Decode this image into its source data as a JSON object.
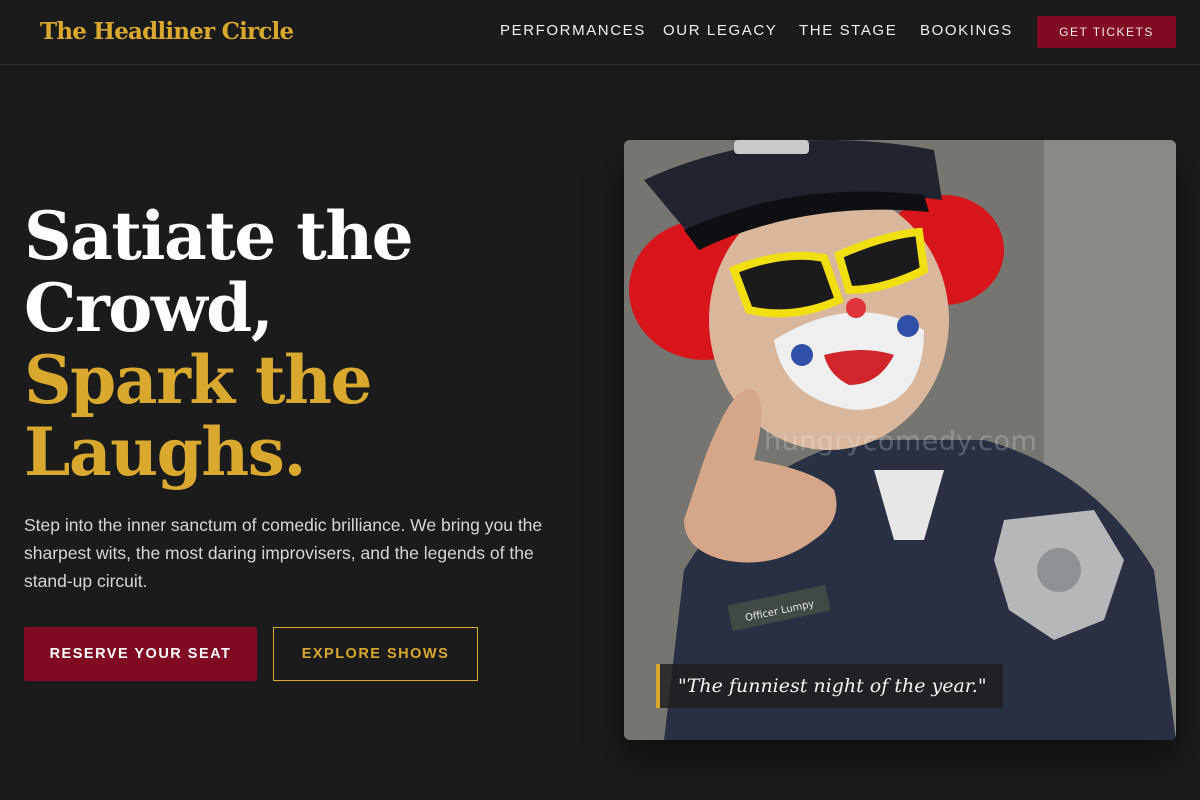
{
  "brand": {
    "name": "The Headliner Circle"
  },
  "nav": {
    "items": [
      "PERFORMANCES",
      "OUR LEGACY",
      "THE STAGE",
      "BOOKINGS"
    ],
    "cta": "GET TICKETS"
  },
  "hero": {
    "headline_line1": "Satiate the",
    "headline_line2": "Crowd,",
    "headline_accent1": "Spark the",
    "headline_accent2": "Laughs.",
    "lede": "Step into the inner sanctum of comedic brilliance. We bring you the sharpest wits, the most daring improvisers, and the legends of the stand-up circuit.",
    "primary_button": "RESERVE YOUR SEAT",
    "secondary_button": "EXPLORE SHOWS"
  },
  "image": {
    "watermark": "hungrycomedy.com",
    "quote": "\"The funniest night of the year.\"",
    "badge_name": "Officer Lumpy"
  },
  "colors": {
    "background": "#1b1b1c",
    "accent_gold": "#d8a92e",
    "accent_maroon": "#7f0a22"
  }
}
